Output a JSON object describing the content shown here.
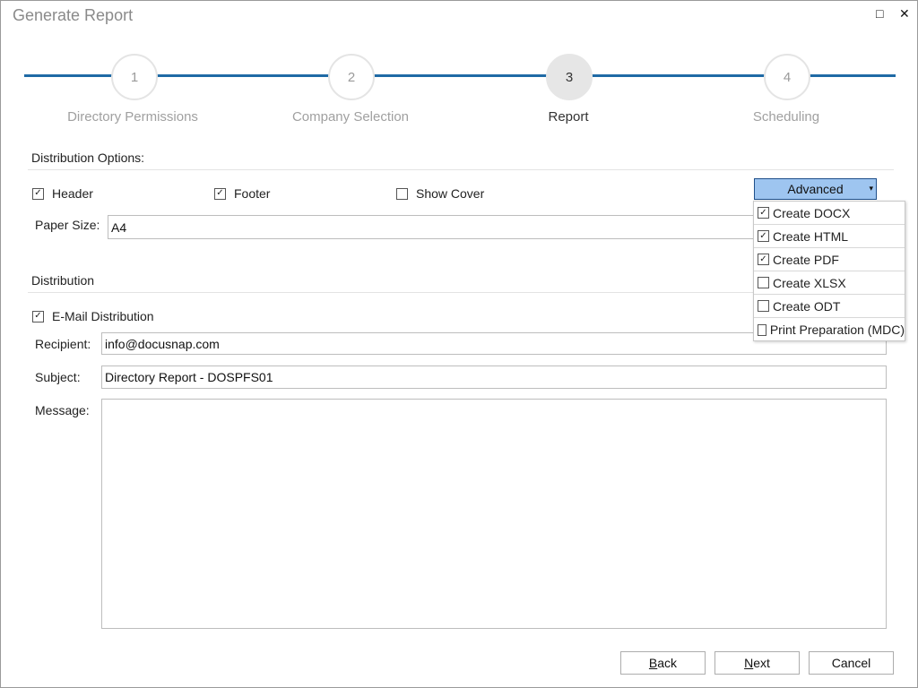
{
  "window": {
    "title": "Generate Report",
    "maximize_glyph": "□",
    "close_glyph": "✕"
  },
  "steps": [
    {
      "number": "1",
      "label": "Directory Permissions"
    },
    {
      "number": "2",
      "label": "Company Selection"
    },
    {
      "number": "3",
      "label": "Report"
    },
    {
      "number": "4",
      "label": "Scheduling"
    }
  ],
  "active_step": 3,
  "distribution_options": {
    "title": "Distribution Options:",
    "header_label": "Header",
    "header_checked": true,
    "footer_label": "Footer",
    "footer_checked": true,
    "cover_label": "Show Cover",
    "cover_checked": false,
    "paper_size_label": "Paper Size:",
    "paper_size_value": "A4"
  },
  "advanced": {
    "label": "Advanced",
    "arrow": "▾",
    "items": [
      {
        "label": "Create DOCX",
        "checked": true
      },
      {
        "label": "Create HTML",
        "checked": true
      },
      {
        "label": "Create PDF",
        "checked": true
      },
      {
        "label": "Create XLSX",
        "checked": false
      },
      {
        "label": "Create ODT",
        "checked": false
      },
      {
        "label": "Print Preparation (MDC)",
        "checked": false
      }
    ]
  },
  "distribution": {
    "title": "Distribution",
    "email_label": "E-Mail Distribution",
    "email_checked": true,
    "recipient_label": "Recipient:",
    "recipient_value": "info@docusnap.com",
    "subject_label": "Subject:",
    "subject_value": "Directory Report - DOSPFS01",
    "message_label": "Message:",
    "message_value": ""
  },
  "buttons": {
    "back_first": "B",
    "back_rest": "ack",
    "next_first": "N",
    "next_rest": "ext",
    "cancel": "Cancel"
  },
  "colors": {
    "accent": "#1f6aa5",
    "advanced_bg": "#9ec5f0"
  }
}
